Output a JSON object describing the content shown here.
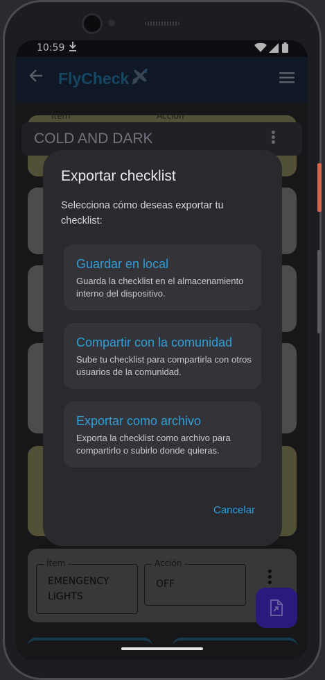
{
  "status_bar": {
    "time": "10:59",
    "download_icon": "download-icon",
    "wifi_icon": "wifi-icon",
    "signal_icon": "signal-icon",
    "battery_icon": "battery-icon"
  },
  "app_bar": {
    "title": "FlyCheck",
    "back_icon": "arrow-back-icon",
    "logo_icon": "airplane-icon",
    "menu_icon": "hamburger-menu-icon"
  },
  "section": {
    "title": "COLD AND DARK"
  },
  "background_card": {
    "item_label": "Ítem",
    "item_value": "EMENGENCY LIGHTS",
    "action_label": "Acción",
    "action_value": "OFF"
  },
  "top_card_labels": {
    "item_label": "Ítem",
    "action_label": "Acción"
  },
  "dialog": {
    "title": "Exportar checklist",
    "body": "Selecciona cómo deseas exportar tu checklist:",
    "options": [
      {
        "title": "Guardar en local",
        "description": "Guarda la checklist en el almacenamiento interno del dispositivo."
      },
      {
        "title": "Compartir con la comunidad",
        "description": "Sube tu checklist para compartirla con otros usuarios de la comunidad."
      },
      {
        "title": "Exportar como archivo",
        "description": "Exporta la checklist como archivo para compartirlo o subirlo donde quieras."
      }
    ],
    "cancel_label": "Cancelar"
  },
  "fab": {
    "icon": "file-export-icon"
  },
  "colors": {
    "accent": "#2f9fd6",
    "fab": "#3b22a8",
    "app_bar": "#142131",
    "dialog": "#2a292e"
  }
}
